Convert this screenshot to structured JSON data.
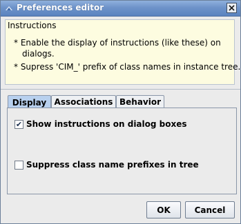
{
  "window": {
    "title": "Preferences editor",
    "title_icon": "java-icon",
    "close_icon": "close-icon"
  },
  "instructions": {
    "heading": "Instructions",
    "lines": [
      "* Enable the display of instructions (like these) on",
      "  dialogs.",
      "* Supress 'CIM_' prefix of class names in instance tree."
    ]
  },
  "tabs": [
    {
      "label": "Display",
      "selected": true
    },
    {
      "label": "Associations",
      "selected": false
    },
    {
      "label": "Behavior",
      "selected": false
    }
  ],
  "display_panel": {
    "options": [
      {
        "label": "Show instructions on dialog boxes",
        "checked": true,
        "mark": "✔"
      },
      {
        "label": "Suppress class name prefixes in tree",
        "checked": false,
        "mark": ""
      }
    ]
  },
  "buttons": {
    "ok": "OK",
    "cancel": "Cancel"
  },
  "colors": {
    "titlebar": "#6e93c9",
    "instructions_bg": "#fdfce0",
    "active_tab": "#b8d0ee"
  }
}
